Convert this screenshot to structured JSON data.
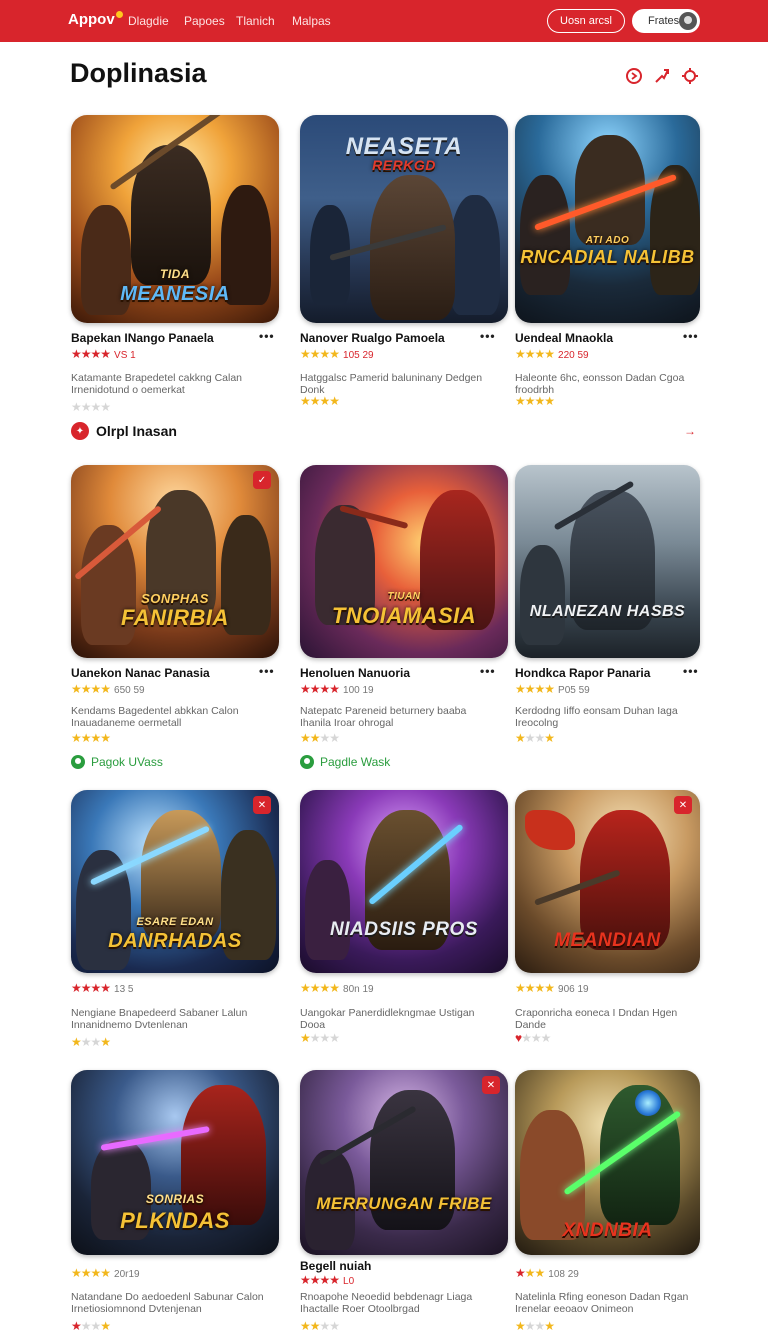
{
  "header": {
    "logo": "Appov",
    "nav": [
      "Dlagdie",
      "Papoes",
      "Tlanich",
      "Malpas"
    ],
    "outline_button": "Uosn arcsl",
    "user_button": "Frates"
  },
  "page_title": "Doplinasia",
  "section1": {
    "label": "Olrpl Inasan"
  },
  "cards": [
    {
      "name": "Bapekan INango Panaela",
      "rating_num": "VS 1",
      "desc": "Katamante Brapedetel cakkng Calan Irnenidotund o oemerkat",
      "art": "MEANESIA",
      "art_sub": "TIDA"
    },
    {
      "name": "Nanover Rualgo Pamoela",
      "rating_num": "105 29",
      "desc": "Hatggalsc Pamerid baluninany Dedgen Donk",
      "art": "NEASETA",
      "art_sub": "RERKGD"
    },
    {
      "name": "Uendeal Mnaokla",
      "rating_num": "220 59",
      "desc": "Haleonte 6hc, eonsson Dadan Cgoa froodrbh",
      "art": "RNCADIAL NALIBB",
      "art_sub": "ATI ADO"
    },
    {
      "name": "Uanekon Nanac Panasia",
      "rating_num": "650 59",
      "desc": "Kendams Bagedentel abkkan Calon Inauadaneme oermetall",
      "art": "FANIRBIA",
      "art_sub": "SONPHAS",
      "link": "Pagok UVass"
    },
    {
      "name": "Henoluen Nanuoria",
      "rating_num": "100 19",
      "desc": "Natepatc Pareneid beturnery baaba Ihanila Iroar ohrogal",
      "art": "TNOIAMASIA",
      "art_sub": "TIUAN",
      "link": "Pagdle Wask"
    },
    {
      "name": "Hondkca Rapor Panaria",
      "rating_num": "P05 59",
      "desc": "Kerdodng Iiffo eonsam Duhan Iaga Ireocolng",
      "art": "NLANEZAN HASBS",
      "art_sub": ""
    },
    {
      "name": "",
      "rating_num": "13 5",
      "desc": "Nengiane Bnapedeerd Sabaner Lalun Innanidnemo Dvtenlenan",
      "art": "DANRHADAS",
      "art_sub": "ESARE EDAN"
    },
    {
      "name": "",
      "rating_num": "80n 19",
      "desc": "Uangokar Panerdidlekngmae Ustigan Dooa",
      "art": "NIADSIIS PROS",
      "art_sub": ""
    },
    {
      "name": "",
      "rating_num": "906 19",
      "desc": "Craponricha eoneca I Dndan Hgen Dande",
      "art": "MEANDIAN",
      "art_sub": ""
    },
    {
      "name": "",
      "rating_num": "20r19",
      "desc": "Natandane Do aedoedenl Sabunar Calon Irnetiosiomnond Dvtenjenan",
      "art": "PLKNDAS",
      "art_sub": "SONRIAS"
    },
    {
      "name": "Begell nuiah",
      "rating_num": "L0",
      "desc": "Rnoapohe Neoedid bebdenagr Liaga Ihactalle Roer Otoolbrgad",
      "art": "MERRUNGAN FRIBE",
      "art_sub": ""
    },
    {
      "name": "",
      "rating_num": "108 29",
      "desc": "Natelinla Rfing eoneson Dadan Rgan Irenelar eeoaov Onimeon",
      "art": "XNDNBIA",
      "art_sub": ""
    }
  ],
  "colors": {
    "accent": "#d8252c",
    "star": "#f2b71c",
    "green": "#2a9d3e"
  },
  "icons": [
    "search-icon",
    "share-icon",
    "settings-icon",
    "more-icon"
  ]
}
